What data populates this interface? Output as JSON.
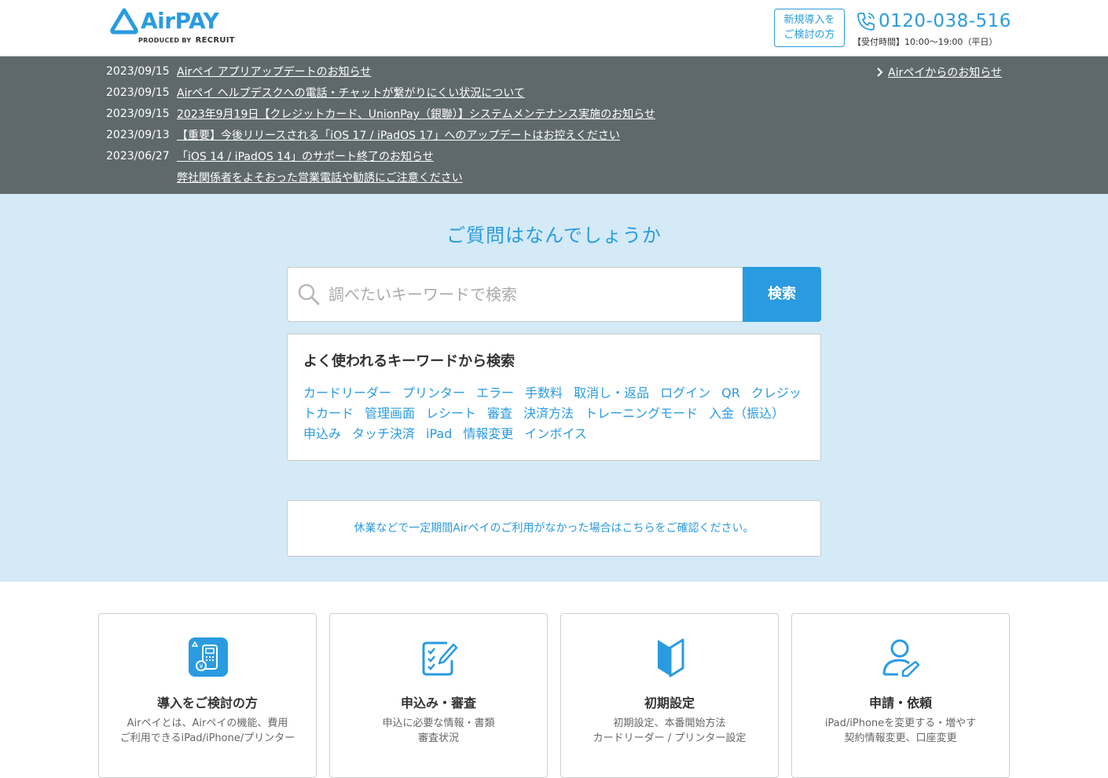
{
  "header": {
    "logo_text": "AirPAY",
    "logo_sub": "PRODUCED BY",
    "logo_brand": "RECRUIT",
    "cta_line1": "新規導入を",
    "cta_line2": "ご検討の方",
    "phone_number": "0120-038-516",
    "phone_hours": "【受付時間】10:00〜19:00（平日）"
  },
  "news": {
    "all_link": "Airペイからのお知らせ",
    "items": [
      {
        "date": "2023/09/15",
        "title": "Airペイ アプリアップデートのお知らせ"
      },
      {
        "date": "2023/09/15",
        "title": "Airペイ ヘルプデスクへの電話・チャットが繋がりにくい状況について"
      },
      {
        "date": "2023/09/15",
        "title": "2023年9月19日【クレジットカード、UnionPay（銀聯）】システムメンテナンス実施のお知らせ"
      },
      {
        "date": "2023/09/13",
        "title": "【重要】今後リリースされる「iOS 17 / iPadOS 17」へのアップデートはお控えください"
      },
      {
        "date": "2023/06/27",
        "title": "「iOS 14 / iPadOS 14」のサポート終了のお知らせ"
      },
      {
        "date": "",
        "title": "弊社関係者をよそおった営業電話や勧誘にご注意ください"
      }
    ]
  },
  "hero": {
    "title": "ご質問はなんでしょうか",
    "search_placeholder": "調べたいキーワードで検索",
    "search_button": "検索",
    "keywords_title": "よく使われるキーワードから検索",
    "keywords": [
      "カードリーダー",
      "プリンター",
      "エラー",
      "手数料",
      "取消し・返品",
      "ログイン",
      "QR",
      "クレジットカード",
      "管理画面",
      "レシート",
      "審査",
      "決済方法",
      "トレーニングモード",
      "入金（振込）",
      "申込み",
      "タッチ決済",
      "iPad",
      "情報変更",
      "インボイス"
    ],
    "notice": "休業などで一定期間Airペイのご利用がなかった場合はこちらをご確認ください。"
  },
  "cards": [
    {
      "icon": "card-reader-icon",
      "title": "導入をご検討の方",
      "desc1": "Airペイとは、Airペイの機能、費用",
      "desc2": "ご利用できるiPad/iPhone/プリンター"
    },
    {
      "icon": "application-form-icon",
      "title": "申込み・審査",
      "desc1": "申込に必要な情報・書類",
      "desc2": "審査状況"
    },
    {
      "icon": "beginner-mark-icon",
      "title": "初期設定",
      "desc1": "初期設定、本番開始方法",
      "desc2": "カードリーダー / プリンター設定"
    },
    {
      "icon": "user-edit-icon",
      "title": "申請・依頼",
      "desc1": "iPad/iPhoneを変更する・増やす",
      "desc2": "契約情報変更、口座変更"
    }
  ],
  "colors": {
    "accent": "#2a9be0",
    "news_bg": "#5f696b",
    "hero_bg": "#d4eaf7"
  }
}
